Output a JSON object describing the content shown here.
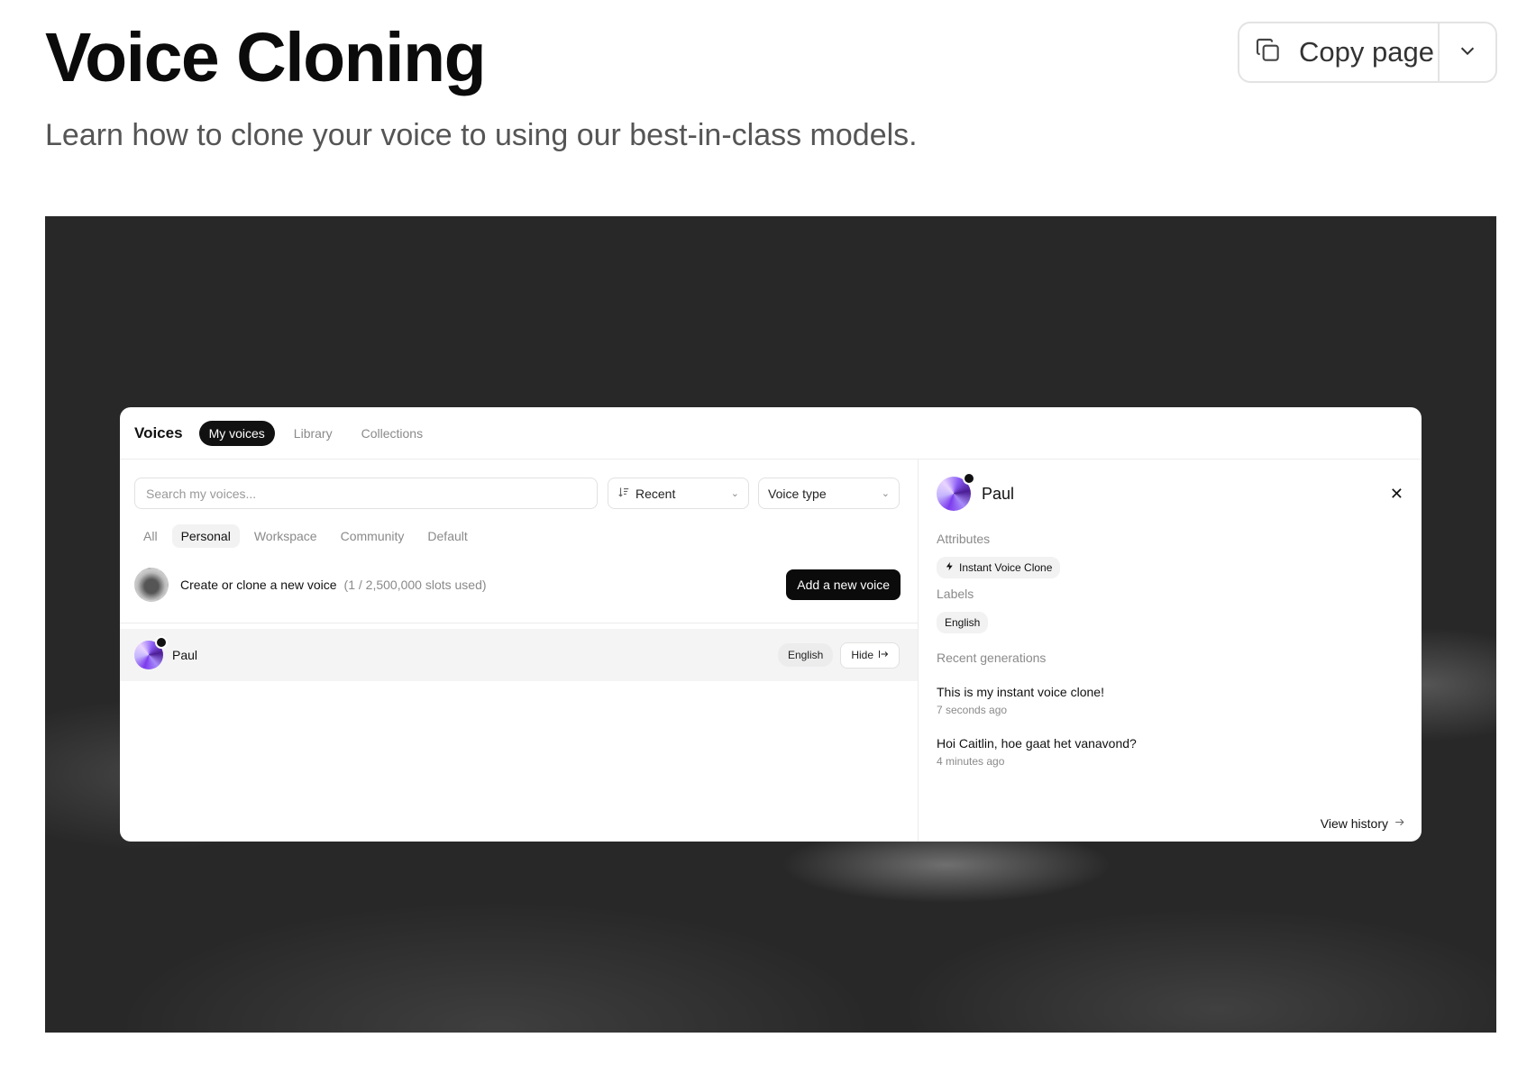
{
  "page": {
    "title": "Voice Cloning",
    "subtitle": "Learn how to clone your voice to using our best-in-class models.",
    "copy_button": "Copy page",
    "icons": {
      "copy": "copy-icon",
      "dropdown": "chevron-down-icon"
    }
  },
  "panel": {
    "title": "Voices",
    "tabs": [
      {
        "label": "My voices",
        "active": true
      },
      {
        "label": "Library",
        "active": false
      },
      {
        "label": "Collections",
        "active": false
      }
    ],
    "search": {
      "placeholder": "Search my voices..."
    },
    "sort": {
      "label": "Recent"
    },
    "voice_type": {
      "label": "Voice type"
    },
    "filters": [
      {
        "label": "All",
        "active": false
      },
      {
        "label": "Personal",
        "active": true
      },
      {
        "label": "Workspace",
        "active": false
      },
      {
        "label": "Community",
        "active": false
      },
      {
        "label": "Default",
        "active": false
      }
    ],
    "create": {
      "text": "Create or clone a new voice",
      "slots": "(1 / 2,500,000 slots used)",
      "button": "Add a new voice"
    },
    "voices": [
      {
        "name": "Paul",
        "language": "English",
        "hide_label": "Hide"
      }
    ],
    "detail": {
      "name": "Paul",
      "attributes_label": "Attributes",
      "attribute": "Instant Voice Clone",
      "labels_label": "Labels",
      "label": "English",
      "recent_label": "Recent generations",
      "generations": [
        {
          "text": "This is my instant voice clone!",
          "time": "7 seconds ago"
        },
        {
          "text": "Hoi Caitlin, hoe gaat het vanavond?",
          "time": "4 minutes ago"
        }
      ],
      "view_history": "View history"
    }
  },
  "colors": {
    "accent": "#0b0b0b",
    "avatar": "#7c3aed",
    "hero_bg": "#282828"
  }
}
